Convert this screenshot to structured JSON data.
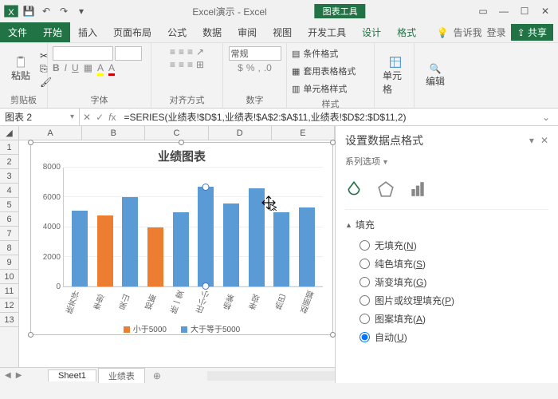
{
  "app": {
    "title": "Excel演示 - Excel",
    "chart_tools": "图表工具"
  },
  "tabs": {
    "file": "文件",
    "home": "开始",
    "insert": "插入",
    "layout": "页面布局",
    "formula": "公式",
    "data": "数据",
    "review": "审阅",
    "view": "视图",
    "dev": "开发工具",
    "design": "设计",
    "format": "格式"
  },
  "ribbon_right": {
    "tell_me": "告诉我",
    "login": "登录",
    "share": "共享"
  },
  "groups": {
    "clipboard": "剪贴板",
    "paste": "粘贴",
    "font": "字体",
    "align": "对齐方式",
    "standard": "常规",
    "number": "数字",
    "cond_fmt": "条件格式",
    "table_fmt": "套用表格格式",
    "cell_style": "单元格样式",
    "styles": "样式",
    "cells": "单元格",
    "editing": "编辑"
  },
  "namebox": "图表 2",
  "formula": "=SERIES(业绩表!$D$1,业绩表!$A$2:$A$11,业绩表!$D$2:$D$11,2)",
  "columns": [
    "A",
    "B",
    "C",
    "D",
    "E"
  ],
  "rows": [
    "1",
    "2",
    "3",
    "4",
    "5",
    "6",
    "7",
    "8",
    "9",
    "10",
    "11",
    "12",
    "13"
  ],
  "chart_data": {
    "type": "bar",
    "title": "业绩图表",
    "categories": [
      "陈芳评",
      "李思",
      "吴山",
      "郑斯",
      "陈一雯",
      "庄小小",
      "杨紫",
      "李现",
      "热巴",
      "赵丽颖"
    ],
    "series": [
      {
        "name": "小于5000",
        "color": "#ed7d31",
        "values": [
          null,
          4800,
          null,
          4000,
          null,
          null,
          null,
          null,
          null,
          null
        ]
      },
      {
        "name": "大于等于5000",
        "color": "#5b9bd5",
        "values": [
          5100,
          null,
          6000,
          null,
          5000,
          6700,
          5600,
          6600,
          5000,
          5300
        ]
      }
    ],
    "ylim": [
      0,
      8000
    ],
    "yticks": [
      0,
      2000,
      4000,
      6000,
      8000
    ],
    "selected_point": {
      "series": 1,
      "index": 5
    },
    "legend": {
      "lt": "小于5000",
      "ge": "大于等于5000"
    }
  },
  "sidepane": {
    "title": "设置数据点格式",
    "subtitle": "系列选项",
    "section_fill": "填充",
    "options": {
      "none": "无填充",
      "none_k": "N",
      "solid": "纯色填充",
      "solid_k": "S",
      "gradient": "渐变填充",
      "gradient_k": "G",
      "picture": "图片或纹理填充",
      "picture_k": "P",
      "pattern": "图案填充",
      "pattern_k": "A",
      "auto": "自动",
      "auto_k": "U"
    }
  },
  "sheets": {
    "active": "Sheet1",
    "other": "业绩表"
  }
}
